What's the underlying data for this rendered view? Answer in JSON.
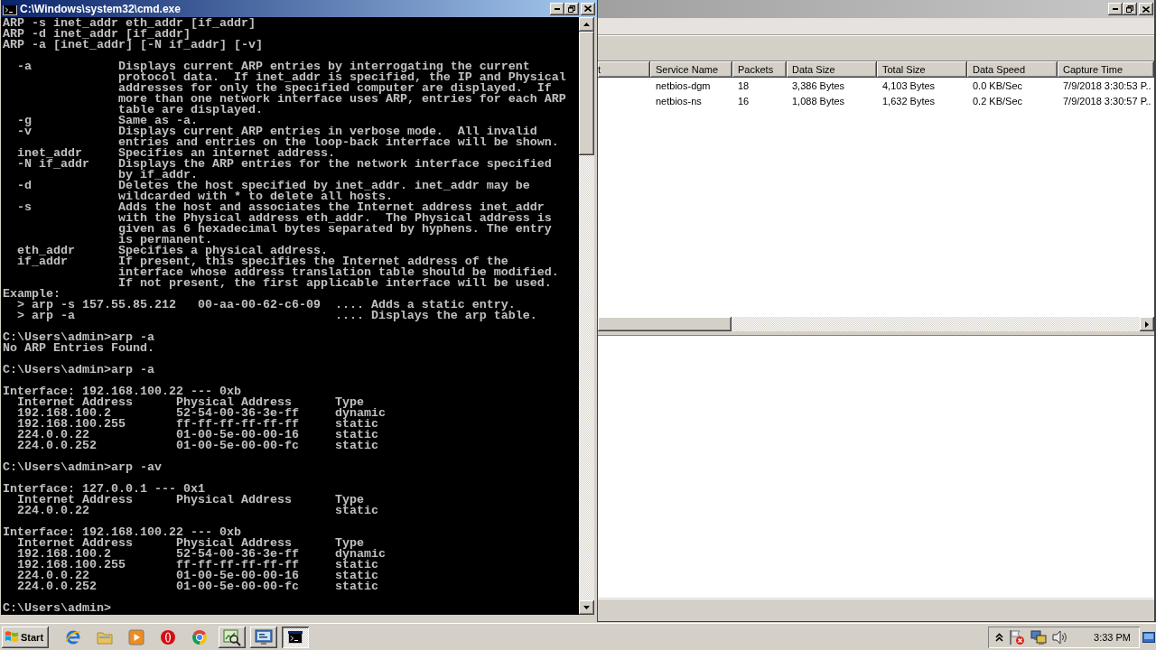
{
  "console_window": {
    "title": "C:\\Windows\\system32\\cmd.exe",
    "blocks": [
      [
        {
          "kind": "text",
          "lines": [
            "ARP -s inet_addr eth_addr [if_addr]",
            "ARP -d inet_addr [if_addr]",
            "ARP -a [inet_addr] [-N if_addr] [-v]"
          ]
        }
      ],
      [
        {
          "kind": "options",
          "options": [
            {
              "flag": "-a",
              "description": [
                "Displays current ARP entries by interrogating the current",
                "protocol data.  If inet_addr is specified, the IP and Physical",
                "addresses for only the specified computer are displayed.  If",
                "more than one network interface uses ARP, entries for each ARP",
                "table are displayed."
              ]
            },
            {
              "flag": "-g",
              "description": [
                "Same as -a."
              ]
            },
            {
              "flag": "-v",
              "description": [
                "Displays current ARP entries in verbose mode.  All invalid",
                "entries and entries on the loop-back interface will be shown."
              ]
            },
            {
              "flag": "inet_addr",
              "description": [
                "Specifies an internet address."
              ]
            },
            {
              "flag": "-N if_addr",
              "description": [
                "Displays the ARP entries for the network interface specified",
                "by if_addr."
              ]
            },
            {
              "flag": "-d",
              "description": [
                "Deletes the host specified by inet_addr. inet_addr may be",
                "wildcarded with * to delete all hosts."
              ]
            },
            {
              "flag": "-s",
              "description": [
                "Adds the host and associates the Internet address inet_addr",
                "with the Physical address eth_addr.  The Physical address is",
                "given as 6 hexadecimal bytes separated by hyphens. The entry",
                "is permanent."
              ]
            },
            {
              "flag": "eth_addr",
              "description": [
                "Specifies a physical address."
              ]
            },
            {
              "flag": "if_addr",
              "description": [
                "If present, this specifies the Internet address of the",
                "interface whose address translation table should be modified.",
                "If not present, the first applicable interface will be used."
              ]
            }
          ]
        },
        {
          "kind": "examples",
          "heading": "Example:",
          "items": [
            {
              "command": "> arp -s 157.55.85.212   00-aa-00-62-c6-09",
              "comment": ".... Adds a static entry."
            },
            {
              "command": "> arp -a",
              "comment": ".... Displays the arp table."
            }
          ]
        }
      ],
      [
        {
          "kind": "text",
          "lines": [
            "C:\\Users\\admin>arp -a",
            "No ARP Entries Found."
          ]
        }
      ],
      [
        {
          "kind": "text",
          "lines": [
            "C:\\Users\\admin>arp -a"
          ]
        }
      ],
      [
        {
          "kind": "arp_table",
          "interface": "Interface: 192.168.100.22 --- 0xb",
          "columns": [
            "Internet Address",
            "Physical Address",
            "Type"
          ],
          "rows": [
            {
              "internet_address": "192.168.100.2",
              "physical_address": "52-54-00-36-3e-ff",
              "type": "dynamic"
            },
            {
              "internet_address": "192.168.100.255",
              "physical_address": "ff-ff-ff-ff-ff-ff",
              "type": "static"
            },
            {
              "internet_address": "224.0.0.22",
              "physical_address": "01-00-5e-00-00-16",
              "type": "static"
            },
            {
              "internet_address": "224.0.0.252",
              "physical_address": "01-00-5e-00-00-fc",
              "type": "static"
            }
          ]
        }
      ],
      [
        {
          "kind": "text",
          "lines": [
            "C:\\Users\\admin>arp -av"
          ]
        }
      ],
      [
        {
          "kind": "arp_table",
          "interface": "Interface: 127.0.0.1 --- 0x1",
          "columns": [
            "Internet Address",
            "Physical Address",
            "Type"
          ],
          "rows": [
            {
              "internet_address": "224.0.0.22",
              "type": "static"
            }
          ]
        }
      ],
      [
        {
          "kind": "arp_table",
          "interface": "Interface: 192.168.100.22 --- 0xb",
          "columns": [
            "Internet Address",
            "Physical Address",
            "Type"
          ],
          "rows": [
            {
              "internet_address": "192.168.100.2",
              "physical_address": "52-54-00-36-3e-ff",
              "type": "dynamic"
            },
            {
              "internet_address": "192.168.100.255",
              "physical_address": "ff-ff-ff-ff-ff-ff",
              "type": "static"
            },
            {
              "internet_address": "224.0.0.22",
              "physical_address": "01-00-5e-00-00-16",
              "type": "static"
            },
            {
              "internet_address": "224.0.0.252",
              "physical_address": "01-00-5e-00-00-fc",
              "type": "static"
            }
          ]
        }
      ],
      [
        {
          "kind": "text",
          "lines": [
            "C:\\Users\\admin>"
          ]
        }
      ]
    ]
  },
  "list_window": {
    "table": {
      "columns": [
        "t",
        "Service Name",
        "Packets",
        "Data Size",
        "Total Size",
        "Data Speed",
        "Capture Time"
      ],
      "rows": [
        [
          "",
          "netbios-dgm",
          "18",
          "3,386 Bytes",
          "4,103 Bytes",
          "0.0 KB/Sec",
          "7/9/2018 3:30:53 P.."
        ],
        [
          "",
          "netbios-ns",
          "16",
          "1,088 Bytes",
          "1,632 Bytes",
          "0.2 KB/Sec",
          "7/9/2018 3:30:57 P.."
        ]
      ]
    }
  },
  "taskbar": {
    "start": "Start",
    "tasks": [
      {
        "selected": false
      },
      {
        "selected": false
      },
      {
        "selected": true
      }
    ],
    "clock": "3:33 PM"
  }
}
